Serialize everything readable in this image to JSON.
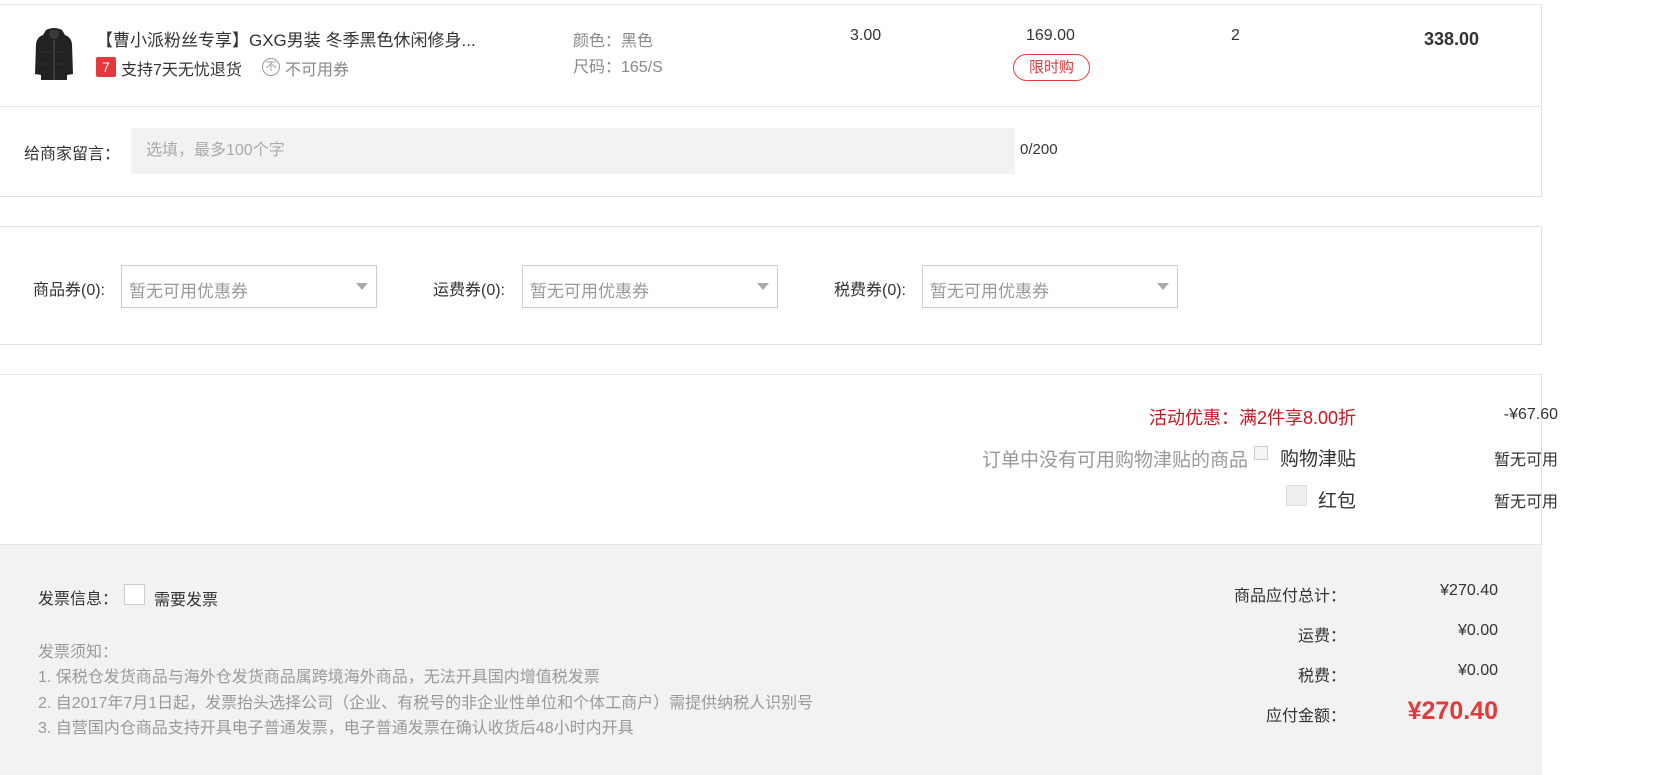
{
  "product": {
    "title": "【曹小派粉丝专享】GXG男装 冬季黑色休闲修身...",
    "return_tag": "7",
    "return_text": "支持7天无忧退货",
    "no_coupon_icon": "不",
    "no_coupon_text": "不可用券",
    "color": "颜色：黑色",
    "size": "尺码：165/S",
    "weight": "3.00",
    "price": "169.00",
    "limit_badge": "限时购",
    "quantity": "2",
    "subtotal": "338.00"
  },
  "message": {
    "label": "给商家留言：",
    "placeholder": "选填，最多100个字",
    "count": "0/200"
  },
  "coupons": [
    {
      "label": "商品券(0):",
      "value": "暂无可用优惠券"
    },
    {
      "label": "运费券(0):",
      "value": "暂无可用优惠券"
    },
    {
      "label": "税费券(0):",
      "value": "暂无可用优惠券"
    }
  ],
  "discounts": {
    "promo_label": "活动优惠：满2件享8.00折",
    "promo_amount": "-¥67.60",
    "allowance_note": "订单中没有可用购物津贴的商品",
    "allowance_label": "购物津贴",
    "allowance_value": "暂无可用",
    "redpack_label": "红包",
    "redpack_value": "暂无可用"
  },
  "invoice": {
    "label": "发票信息：",
    "need_label": "需要发票",
    "notice_title": "发票须知：",
    "notices": [
      "1. 保税仓发货商品与海外仓发货商品属跨境海外商品，无法开具国内增值税发票",
      "2. 自2017年7月1日起，发票抬头选择公司（企业、有税号的非企业性单位和个体工商户）需提供纳税人识别号",
      "3. 自营国内仓商品支持开具电子普通发票，电子普通发票在确认收货后48小时内开具"
    ]
  },
  "summary": {
    "goods_label": "商品应付总计：",
    "goods_value": "¥270.40",
    "shipping_label": "运费：",
    "shipping_value": "¥0.00",
    "tax_label": "税费：",
    "tax_value": "¥0.00",
    "total_label": "应付金额：",
    "total_value": "¥270.40"
  },
  "colors": {
    "accent_red": "#e4393c",
    "promo_red": "#c81623"
  }
}
